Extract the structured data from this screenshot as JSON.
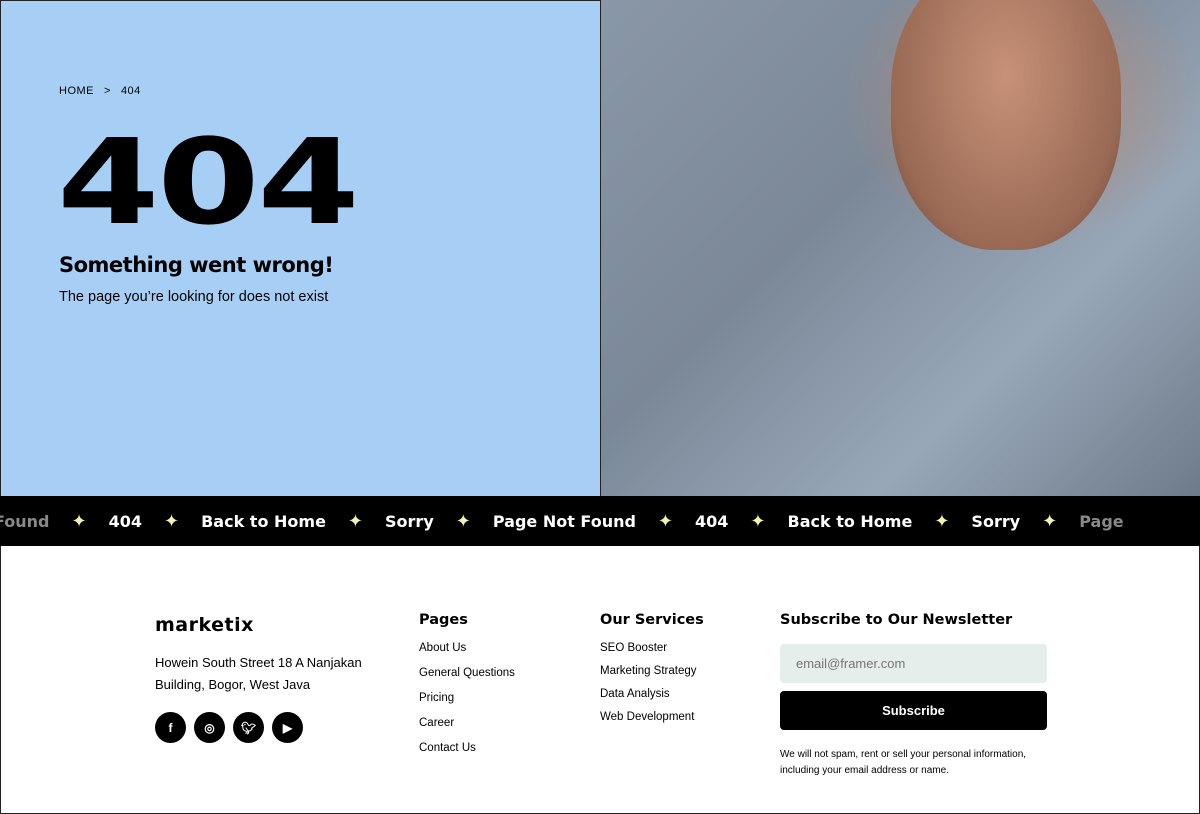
{
  "breadcrumb": {
    "home": "HOME",
    "sep": ">",
    "current": "404"
  },
  "hero": {
    "code": "404",
    "title": "Something went wrong!",
    "subtitle": "The page you’re looking for does not exist"
  },
  "marquee": [
    "Found",
    "404",
    "Back to Home",
    "Sorry",
    "Page Not Found",
    "404",
    "Back to Home",
    "Sorry",
    "Page"
  ],
  "footer": {
    "logo": "marketix",
    "address": "Howein South Street 18 A Nanjakan Building, Bogor, West Java",
    "social": [
      "facebook-icon",
      "instagram-icon",
      "twitter-icon",
      "youtube-icon"
    ],
    "pages": {
      "title": "Pages",
      "items": [
        "About Us",
        "General Questions",
        "Pricing",
        "Career",
        "Contact Us"
      ]
    },
    "services": {
      "title": "Our Services",
      "items": [
        "SEO Booster",
        "Marketing Strategy",
        "Data Analysis",
        "Web Development"
      ]
    },
    "newsletter": {
      "title": "Subscribe to Our Newsletter",
      "placeholder": "email@framer.com",
      "button": "Subscribe",
      "note": "We will not spam, rent or sell your personal information, including your email address or name."
    }
  },
  "colors": {
    "hero_bg": "#a7cff6",
    "star": "#f3f4b0"
  }
}
